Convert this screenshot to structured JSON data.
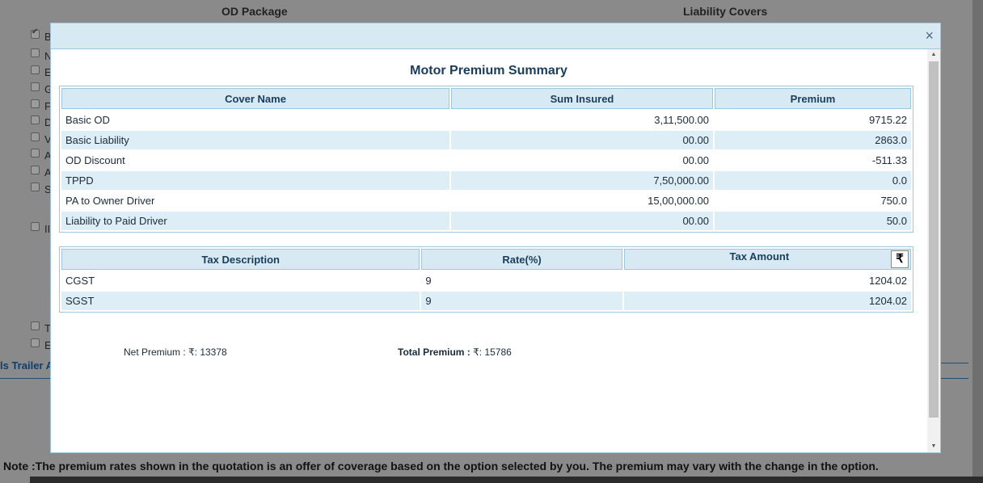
{
  "background": {
    "headers": {
      "od_package": "OD Package",
      "liability_covers": "Liability Covers"
    },
    "checkbox_letters": [
      "B",
      "N",
      "E",
      "G",
      "F",
      "D",
      "V",
      "A",
      "A",
      "S",
      "II",
      "T",
      "E"
    ],
    "trailer_label": "ls Trailer A",
    "note": "Note :The premium rates shown in the quotation is an offer of coverage based on the option selected by you. The premium may vary with the change in the option."
  },
  "modal": {
    "close_glyph": "×",
    "title": "Motor Premium Summary",
    "cover_table": {
      "headers": [
        "Cover Name",
        "Sum Insured",
        "Premium"
      ],
      "rows": [
        {
          "name": "Basic OD",
          "sum_insured": "3,11,500.00",
          "premium": "9715.22"
        },
        {
          "name": "Basic Liability",
          "sum_insured": "00.00",
          "premium": "2863.0"
        },
        {
          "name": "OD Discount",
          "sum_insured": "00.00",
          "premium": "-511.33"
        },
        {
          "name": "TPPD",
          "sum_insured": "7,50,000.00",
          "premium": "0.0"
        },
        {
          "name": "PA to Owner Driver",
          "sum_insured": "15,00,000.00",
          "premium": "750.0"
        },
        {
          "name": "Liability to Paid Driver",
          "sum_insured": "00.00",
          "premium": "50.0"
        }
      ]
    },
    "tax_table": {
      "headers": [
        "Tax Description",
        "Rate(%)",
        "Tax Amount"
      ],
      "currency_symbol": "₹",
      "rows": [
        {
          "description": "CGST",
          "rate": "9",
          "amount": "1204.02"
        },
        {
          "description": "SGST",
          "rate": "9",
          "amount": "1204.02"
        }
      ]
    },
    "net_premium": {
      "label": "Net Premium : ",
      "symbol": "₹",
      "value": ": 13378"
    },
    "total_premium": {
      "label": "Total Premium : ",
      "symbol": "₹",
      "value": ": 15786"
    }
  }
}
